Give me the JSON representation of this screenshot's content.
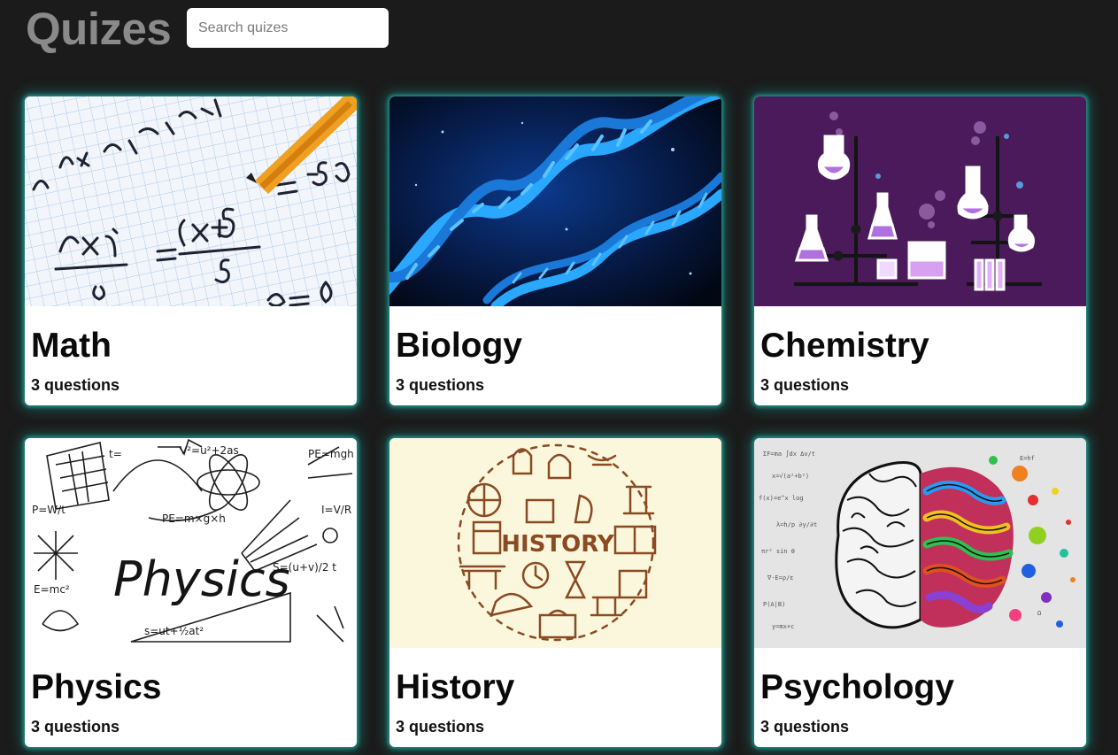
{
  "header": {
    "title": "Quizes",
    "search_placeholder": "Search quizes",
    "search_value": ""
  },
  "quizzes": [
    {
      "title": "Math",
      "count": "3 questions",
      "image": "math-notebook-image"
    },
    {
      "title": "Biology",
      "count": "3 questions",
      "image": "dna-helix-image"
    },
    {
      "title": "Chemistry",
      "count": "3 questions",
      "image": "lab-flasks-image",
      "bg": "#4a1a5a"
    },
    {
      "title": "Physics",
      "count": "3 questions",
      "image": "physics-doodles-image",
      "image_text": "Physics"
    },
    {
      "title": "History",
      "count": "3 questions",
      "image": "history-icons-image",
      "image_text": "HISTORY",
      "bg": "#fbf7dc"
    },
    {
      "title": "Psychology",
      "count": "3 questions",
      "image": "colorful-brain-image"
    }
  ],
  "colors": {
    "page_bg": "#1b1b1b",
    "card_glow": "#28a096",
    "title_gray": "#8a8a8a"
  }
}
